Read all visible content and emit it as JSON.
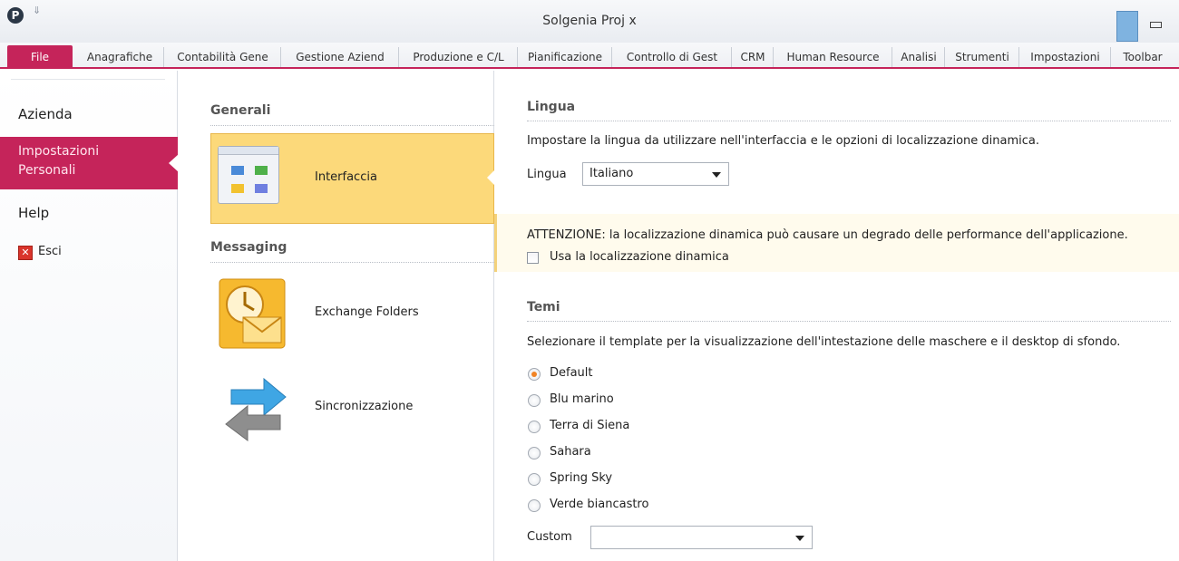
{
  "titlebar": {
    "title": "Solgenia Proj x",
    "logo_letter": "P",
    "quick_access_glyph": "⇓"
  },
  "ribbon": {
    "file_label": "File",
    "tabs": [
      "Anagrafiche",
      "Contabilità Gene",
      "Gestione Aziend",
      "Produzione e C/L",
      "Pianificazione",
      "Controllo di Gest",
      "CRM",
      "Human Resource",
      "Analisi",
      "Strumenti",
      "Impostazioni",
      "Toolbar"
    ]
  },
  "leftnav": {
    "items": [
      "Azienda",
      "Impostazioni Personali",
      "Help"
    ],
    "active_lines": [
      "Impostazioni",
      "Personali"
    ],
    "exit_label": "Esci",
    "exit_glyph": "✕"
  },
  "mid": {
    "section_general": "Generali",
    "section_messaging": "Messaging",
    "cards": [
      "Interfaccia",
      "Exchange Folders",
      "Sincronizzazione"
    ]
  },
  "lingua": {
    "title": "Lingua",
    "description": "Impostare la lingua da utilizzare nell'interfaccia e le opzioni di localizzazione dinamica.",
    "field_label": "Lingua",
    "value": "Italiano",
    "warning": "ATTENZIONE: la localizzazione dinamica può causare un degrado delle performance dell'applicazione.",
    "checkbox_label": "Usa la localizzazione dinamica",
    "checkbox_checked": false
  },
  "temi": {
    "title": "Temi",
    "description": "Selezionare il template per la visualizzazione dell'intestazione delle maschere e il desktop di sfondo.",
    "options": [
      "Default",
      "Blu marino",
      "Terra di Siena",
      "Sahara",
      "Spring Sky",
      "Verde biancastro"
    ],
    "selected": "Default",
    "custom_label": "Custom",
    "custom_value": ""
  },
  "colors": {
    "accent": "#c5245a",
    "selected_card": "#fcd97a",
    "warning_band": "#fffbed",
    "radio_selected": "#f08324"
  }
}
